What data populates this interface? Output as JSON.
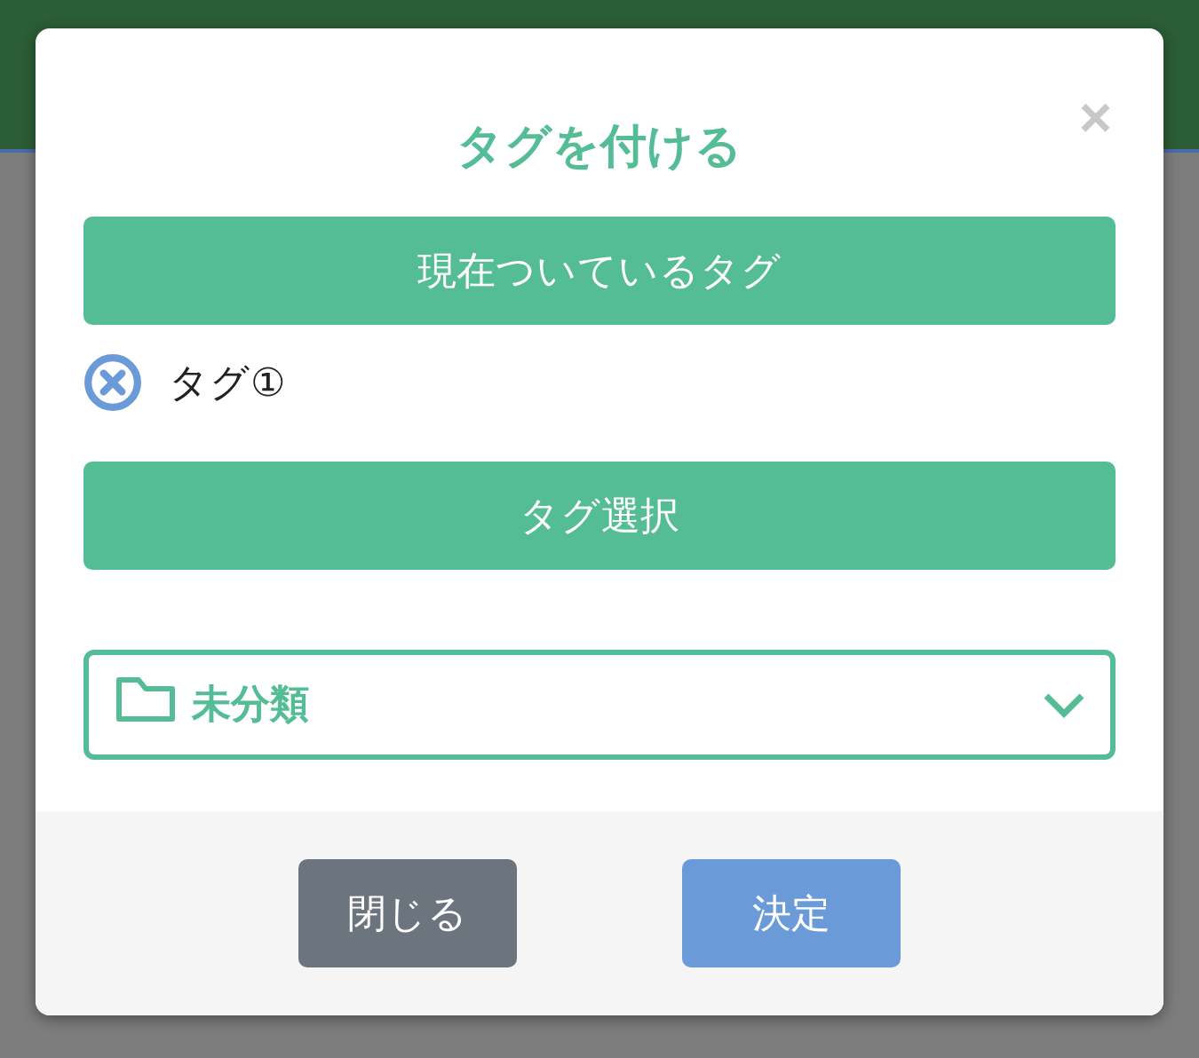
{
  "dialog": {
    "title": "タグを付ける",
    "close": "×",
    "current_header": "現在ついているタグ",
    "tags": [
      {
        "label": "タグ①"
      }
    ],
    "select_header": "タグ選択",
    "folder_select": {
      "value": "未分類"
    },
    "buttons": [
      {
        "label": "閉じる",
        "kind": "secondary"
      },
      {
        "label": "決定",
        "kind": "primary"
      }
    ]
  }
}
